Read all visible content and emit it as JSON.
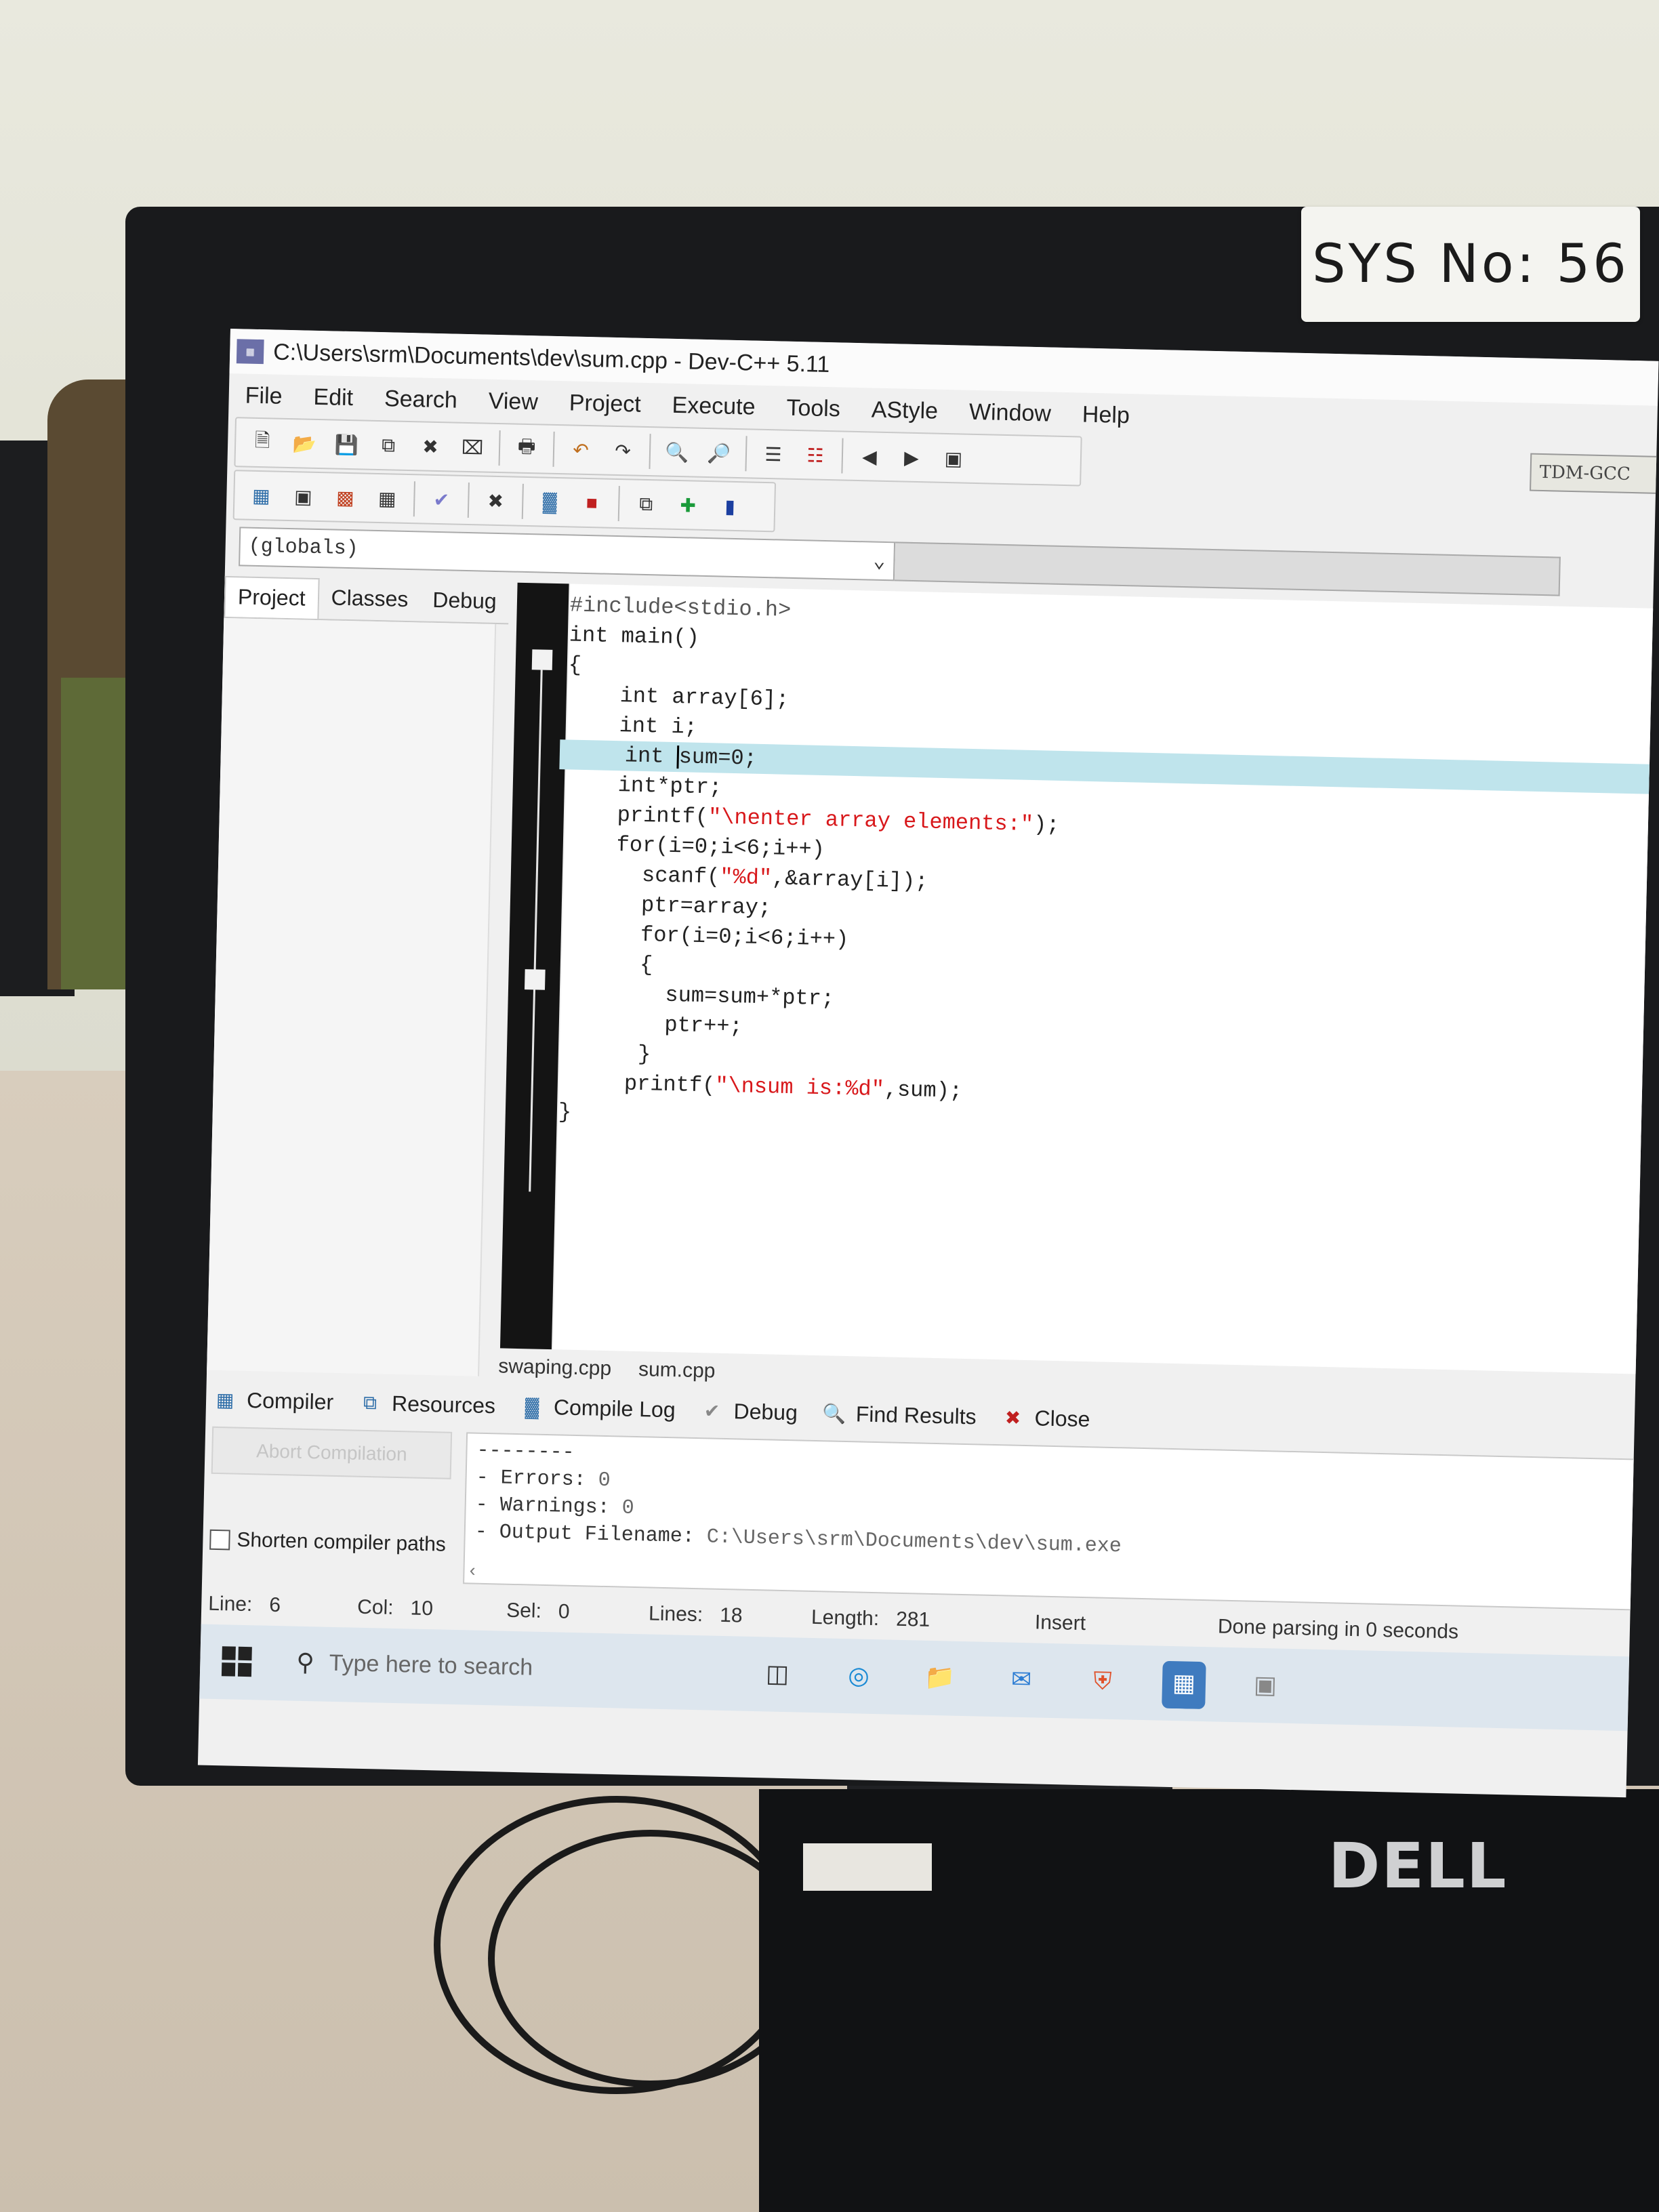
{
  "sticker": "SYS  No: 56",
  "brand": "DELL",
  "window": {
    "title": "C:\\Users\\srm\\Documents\\dev\\sum.cpp - Dev-C++ 5.11"
  },
  "menu": [
    "File",
    "Edit",
    "Search",
    "View",
    "Project",
    "Execute",
    "Tools",
    "AStyle",
    "Window",
    "Help"
  ],
  "compiler_select": "TDM-GCC",
  "scope_select": "(globals)",
  "left_tabs": [
    "Project",
    "Classes",
    "Debug"
  ],
  "code_lines": [
    "#include<stdio.h>",
    "int main()",
    "{",
    "    int array[6];",
    "    int i;",
    "     int ",
    "    int*ptr;",
    "    printf(",
    "    for(i=0;i<6;i++)",
    "      scanf(",
    "      ptr=array;",
    "      for(i=0;i<6;i++)",
    "      {",
    "        sum=sum+*ptr;",
    "        ptr++;",
    "      }",
    "     printf(",
    "}"
  ],
  "code_tokens": {
    "sum_decl": "sum=0;",
    "printf1_str": "\"\\nenter array elements:\"",
    "printf1_tail": ");",
    "scanf_str": "\"%d\"",
    "scanf_tail": ",&array[i]);",
    "printf2_str": "\"\\nsum is:%d\"",
    "printf2_tail": ",sum);"
  },
  "file_tabs": [
    "swaping.cpp",
    "sum.cpp"
  ],
  "bottom_tabs": [
    "Compiler",
    "Resources",
    "Compile Log",
    "Debug",
    "Find Results",
    "Close"
  ],
  "abort_button": "Abort Compilation",
  "shorten_paths": "Shorten compiler paths",
  "log": {
    "separator": "--------",
    "errors_label": "- Errors: ",
    "errors": "0",
    "warnings_label": "- Warnings: ",
    "warnings": "0",
    "output_label": "- Output Filename: ",
    "output": "C:\\Users\\srm\\Documents\\dev\\sum.exe"
  },
  "status": {
    "line_label": "Line:",
    "line": "6",
    "col_label": "Col:",
    "col": "10",
    "sel_label": "Sel:",
    "sel": "0",
    "lines_label": "Lines:",
    "lines": "18",
    "length_label": "Length:",
    "length": "281",
    "mode": "Insert",
    "message": "Done parsing in 0 seconds"
  },
  "taskbar": {
    "search_placeholder": "Type here to search"
  },
  "colors": {
    "current_line": "#bfe4ec",
    "string": "#d8181b",
    "gutter": "#141414"
  }
}
